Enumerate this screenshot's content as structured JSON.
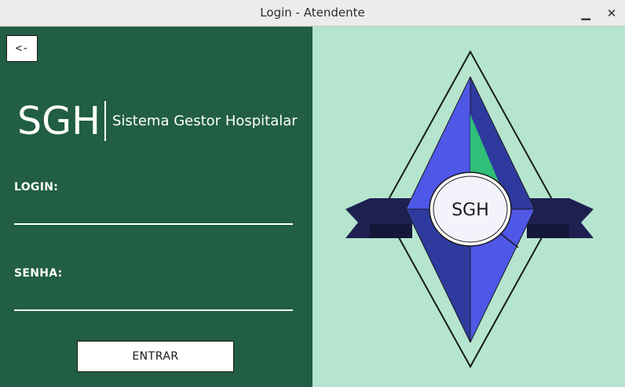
{
  "window": {
    "title": "Login - Atendente",
    "minimize_glyph": "▁",
    "close_glyph": "✕"
  },
  "left": {
    "back_label": "<-",
    "brand_short": "SGH",
    "brand_full": "Sistema Gestor Hospitalar",
    "login_label": "LOGIN:",
    "login_value": "",
    "senha_label": "SENHA:",
    "senha_value": "",
    "enter_label": "ENTRAR"
  },
  "emblem": {
    "text": "SGH"
  },
  "colors": {
    "left_panel_bg": "#215e43",
    "right_panel_bg": "#b5e5cf",
    "diamond_blue": "#4e57e6",
    "diamond_dark_blue": "#2e3a9e",
    "ribbon_navy": "#1e2150",
    "accent_green": "#2fbf78"
  }
}
